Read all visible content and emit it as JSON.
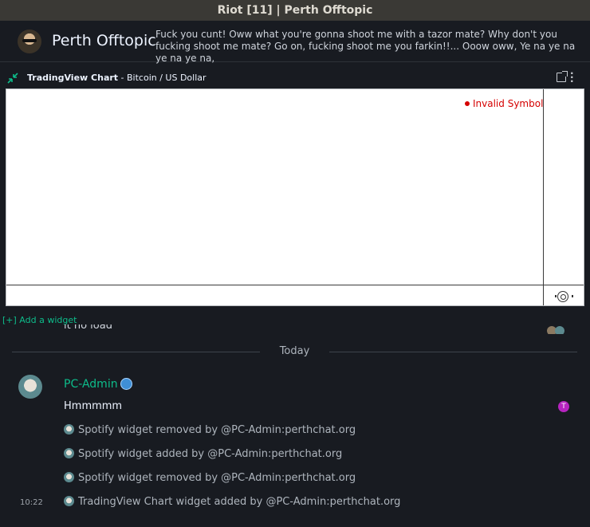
{
  "window": {
    "title": "Riot [11] | Perth Offtopic"
  },
  "room": {
    "name": "Perth Offtopic",
    "topic": "Fuck you cunt! Oww what you're gonna shoot me with a tazor mate? Why don't you fucking shoot me mate? Go on, fucking shoot me you farkin!!... Ooow oww, Ye na ye na ye na ye na,"
  },
  "widget": {
    "name": "TradingView Chart",
    "subtitle": "- Bitcoin / US Dollar",
    "status": "Invalid Symbol",
    "add_label": "[+] Add a widget"
  },
  "timeline": {
    "previous_message": "it no load",
    "date_separator": "Today",
    "sender": "PC-Admin",
    "message": "Hmmmmm",
    "receipt_initial": "T",
    "events": [
      "Spotify widget removed by @PC-Admin:perthchat.org",
      "Spotify widget added by @PC-Admin:perthchat.org",
      "Spotify widget removed by @PC-Admin:perthchat.org",
      "TradingView Chart widget added by @PC-Admin:perthchat.org"
    ],
    "last_timestamp": "10:22"
  },
  "colors": {
    "accent": "#0dbd8b",
    "error": "#d50000",
    "background": "#181b21"
  },
  "icons": [
    "minimize-icon",
    "popout-icon",
    "menu-icon",
    "settings-icon",
    "room-avatar",
    "user-avatar"
  ]
}
